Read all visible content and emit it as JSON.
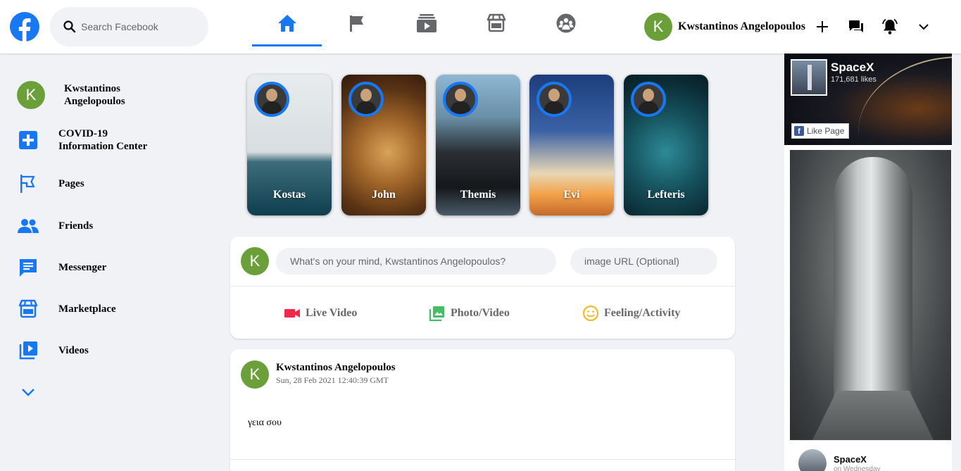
{
  "header": {
    "search_placeholder": "Search Facebook",
    "user": {
      "initial": "K",
      "name": "Kwstantinos Angelopoulos"
    },
    "nav_tabs": [
      {
        "icon": "home-icon",
        "active": true
      },
      {
        "icon": "flag-icon",
        "active": false
      },
      {
        "icon": "watch-icon",
        "active": false
      },
      {
        "icon": "marketplace-icon",
        "active": false
      },
      {
        "icon": "groups-icon",
        "active": false
      }
    ],
    "right_icons": [
      "plus-icon",
      "messenger-icon",
      "bell-icon",
      "chevron-down-icon"
    ]
  },
  "sidebar": {
    "profile": {
      "initial": "K",
      "name": "Kwstantinos Angelopoulos"
    },
    "items": [
      {
        "label": "COVID-19 Information Center",
        "icon": "covid-plus-icon"
      },
      {
        "label": "Pages",
        "icon": "flag-icon"
      },
      {
        "label": "Friends",
        "icon": "friends-icon"
      },
      {
        "label": "Messenger",
        "icon": "messenger-icon"
      },
      {
        "label": "Marketplace",
        "icon": "marketplace-icon"
      },
      {
        "label": "Videos",
        "icon": "video-icon"
      }
    ],
    "more_icon": "chevron-down-icon"
  },
  "stories": [
    {
      "name": "Kostas"
    },
    {
      "name": "John"
    },
    {
      "name": "Themis"
    },
    {
      "name": "Evi"
    },
    {
      "name": "Lefteris"
    }
  ],
  "composer": {
    "initial": "K",
    "status_placeholder": "What's on your mind, Kwstantinos Angelopoulos?",
    "image_placeholder": "image URL (Optional)",
    "actions": [
      {
        "label": "Live Video",
        "icon": "live-video-icon",
        "color": "#f02849"
      },
      {
        "label": "Photo/Video",
        "icon": "photo-icon",
        "color": "#45bd62"
      },
      {
        "label": "Feeling/Activity",
        "icon": "smile-icon",
        "color": "#f7b928"
      }
    ]
  },
  "post": {
    "initial": "K",
    "author": "Kwstantinos Angelopoulos",
    "timestamp": "Sun, 28 Feb 2021 12:40:39 GMT",
    "text": "γεια σου"
  },
  "ad": {
    "page_name": "SpaceX",
    "likes": "171,681 likes",
    "like_button": "Like Page",
    "footer_name": "SpaceX",
    "footer_sub": "on Wednesday"
  },
  "colors": {
    "accent": "#1877f2",
    "avatar": "#6a9f3a",
    "background": "#f0f2f5"
  }
}
